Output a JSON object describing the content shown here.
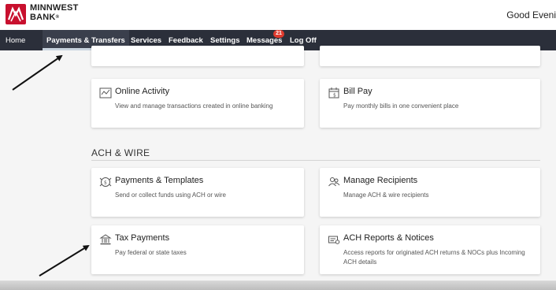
{
  "header": {
    "brand_line1": "MINNWEST",
    "brand_line2": "BANK",
    "brand_mark": "®",
    "greeting": "Good Eveni"
  },
  "nav": {
    "items": [
      {
        "label": "Home"
      },
      {
        "label": "Payments & Transfers"
      },
      {
        "label": "Services"
      },
      {
        "label": "Feedback"
      },
      {
        "label": "Settings"
      },
      {
        "label": "Messages"
      },
      {
        "label": "Log Off"
      }
    ],
    "messages_badge": "21"
  },
  "cards": {
    "online_activity": {
      "title": "Online Activity",
      "desc": "View and manage transactions created in online banking",
      "icon": "activity-chart-icon"
    },
    "bill_pay": {
      "title": "Bill Pay",
      "desc": "Pay monthly bills in one convenient place",
      "icon": "calendar-icon"
    },
    "payments_templates": {
      "title": "Payments & Templates",
      "desc": "Send or collect funds using ACH or wire",
      "icon": "money-stack-icon"
    },
    "manage_recipients": {
      "title": "Manage Recipients",
      "desc": "Manage ACH & wire recipients",
      "icon": "people-icon"
    },
    "tax_payments": {
      "title": "Tax Payments",
      "desc": "Pay federal or state taxes",
      "icon": "government-building-icon"
    },
    "ach_reports": {
      "title": "ACH Reports & Notices",
      "desc": "Access reports for originated ACH returns & NOCs plus Incoming ACH details",
      "icon": "report-icon"
    }
  },
  "section": {
    "title": "ACH & WIRE"
  },
  "colors": {
    "nav_bg": "#2b2f3a",
    "brand_red": "#c8102e",
    "badge_red": "#e03b2e"
  }
}
